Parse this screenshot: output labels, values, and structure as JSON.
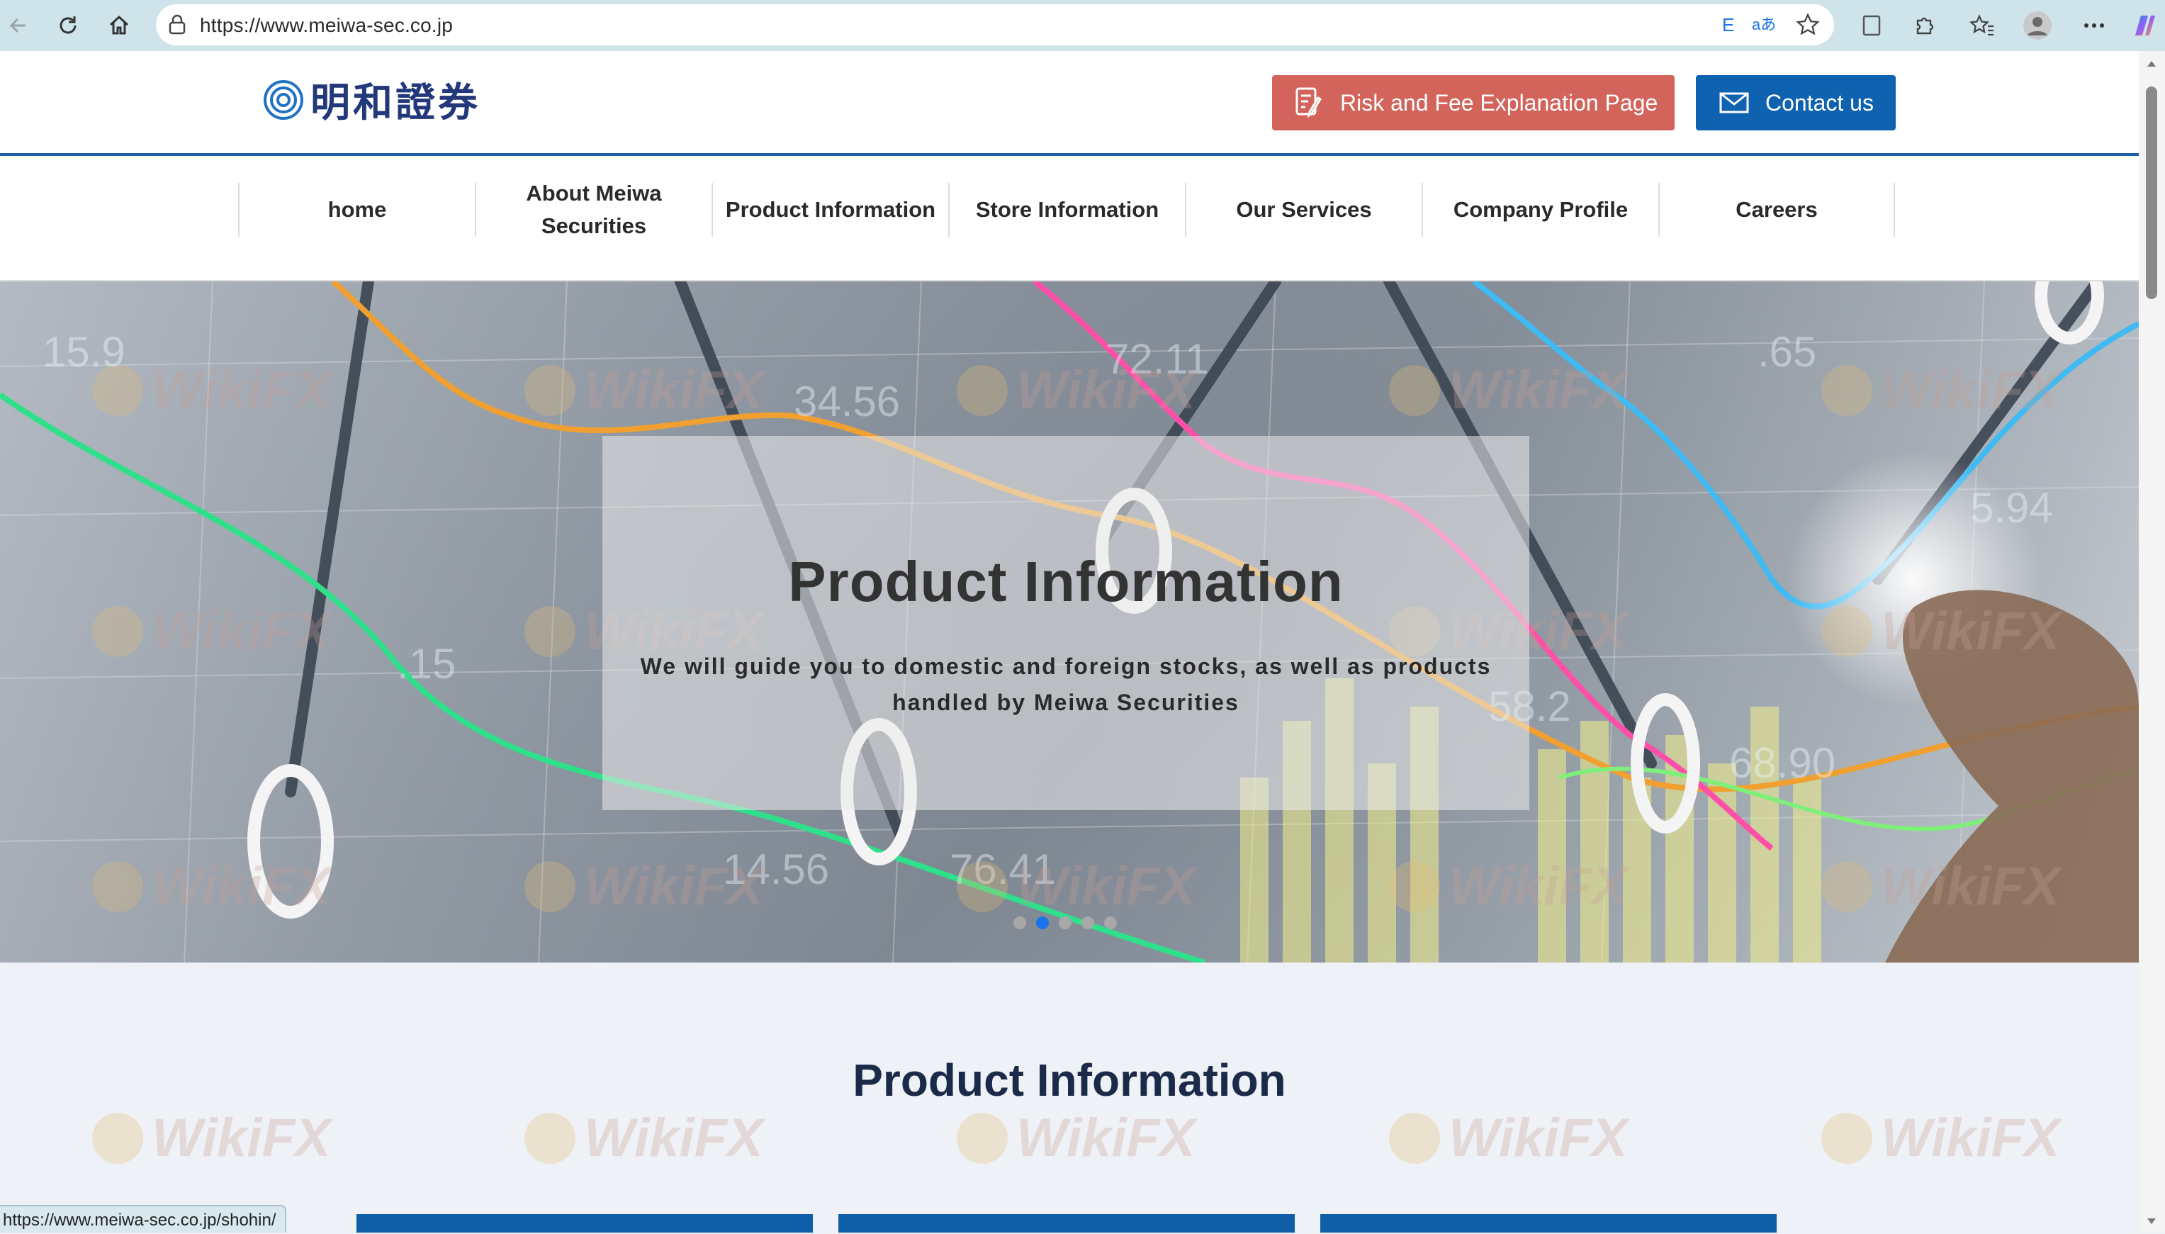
{
  "browser": {
    "url": "https://www.meiwa-sec.co.jp",
    "status_url": "https://www.meiwa-sec.co.jp/shohin/"
  },
  "header": {
    "logo_text": "明和證券",
    "risk_button": "Risk and Fee Explanation Page",
    "contact_button": "Contact us"
  },
  "nav": {
    "items": [
      {
        "label": "home"
      },
      {
        "label": "About Meiwa Securities"
      },
      {
        "label": "Product Information"
      },
      {
        "label": "Store Information"
      },
      {
        "label": "Our Services"
      },
      {
        "label": "Company Profile"
      },
      {
        "label": "Careers"
      }
    ]
  },
  "hero": {
    "title": "Product Information",
    "subtitle": "We will guide you to domestic and foreign stocks, as well as products handled by Meiwa Securities",
    "slide_count": 5,
    "active_slide": 2
  },
  "section": {
    "title": "Product Information"
  },
  "watermark": "WikiFX",
  "colors": {
    "brand_blue": "#0f62b0",
    "risk_red": "#d2645c",
    "header_line": "#1c5fa3",
    "logo_navy": "#22387a"
  }
}
